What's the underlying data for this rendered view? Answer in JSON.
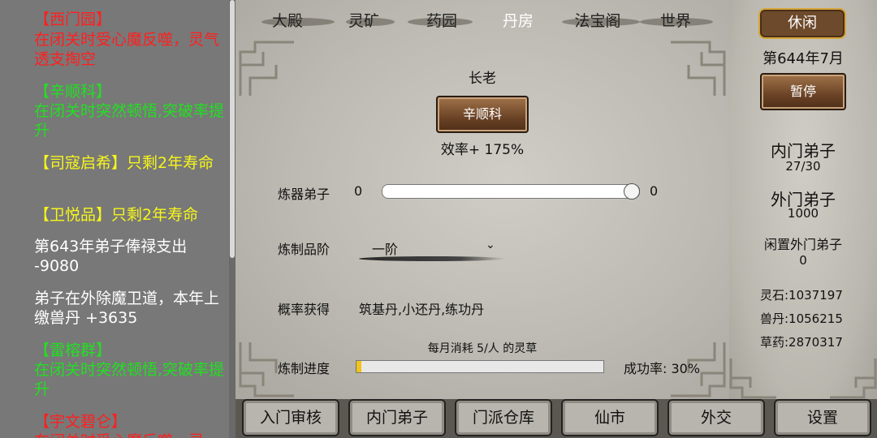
{
  "log": {
    "entries": [
      {
        "text": "【西门园】",
        "color": "red"
      },
      {
        "text": "在闭关时受心魔反噬，灵气透支掏空",
        "color": "red"
      },
      {
        "text": "【辛顺科】",
        "color": "green"
      },
      {
        "text": "在闭关时突然顿悟,突破率提升",
        "color": "green"
      },
      {
        "text": "【司寇启希】只剩2年寿命",
        "color": "yellow"
      },
      {
        "text": "【卫悦品】只剩2年寿命",
        "color": "yellow"
      },
      {
        "text": "第643年弟子俸禄支出 -9080",
        "color": "white"
      },
      {
        "text": "弟子在外除魔卫道，本年上缴兽丹 +3635",
        "color": "white"
      },
      {
        "text": "【雷榕群】",
        "color": "green"
      },
      {
        "text": "在闭关时突然顿悟,突破率提升",
        "color": "green"
      },
      {
        "text": "【宇文碧仑】",
        "color": "red"
      },
      {
        "text": "在闭关时受心魔反噬，灵",
        "color": "red"
      }
    ]
  },
  "tabs": [
    "大殿",
    "灵矿",
    "药园",
    "丹房",
    "法宝阁",
    "世界"
  ],
  "active_tab": "丹房",
  "alchemy": {
    "elder_label": "长老",
    "elder_name": "辛顺科",
    "efficiency": "效率+ 175%",
    "disciples_label": "炼器弟子",
    "disciples_min": "0",
    "disciples_value": "0",
    "disciples_fraction": 1.0,
    "grade_label": "炼制品阶",
    "grade_value": "一阶",
    "chance_label": "概率获得",
    "chance_items": "筑基丹,小还丹,练功丹",
    "consume_text": "每月消耗 5/人 的灵草",
    "progress_label": "炼制进度",
    "progress_fraction": 0.02,
    "success_rate": "成功率: 30%"
  },
  "status": {
    "idle_label": "休闲",
    "date": "第644年7月",
    "pause_label": "暂停",
    "inner_disciples_label": "内门弟子",
    "inner_disciples_value": "27/30",
    "outer_disciples_label": "外门弟子",
    "outer_disciples_value": "1000",
    "idle_outer_label": "闲置外门弟子",
    "idle_outer_value": "0",
    "spirit_stone": "灵石:1037197",
    "beast_pill": "兽丹:1056215",
    "herbs": "草药:2870317"
  },
  "bottom_nav": [
    "入门审核",
    "内门弟子",
    "门派仓库",
    "仙市",
    "外交",
    "设置"
  ],
  "colors": {
    "red": "#ff1f1f",
    "green": "#21e021",
    "yellow": "#f6f61c",
    "white": "#ffffff",
    "progress": "#f2c319"
  }
}
